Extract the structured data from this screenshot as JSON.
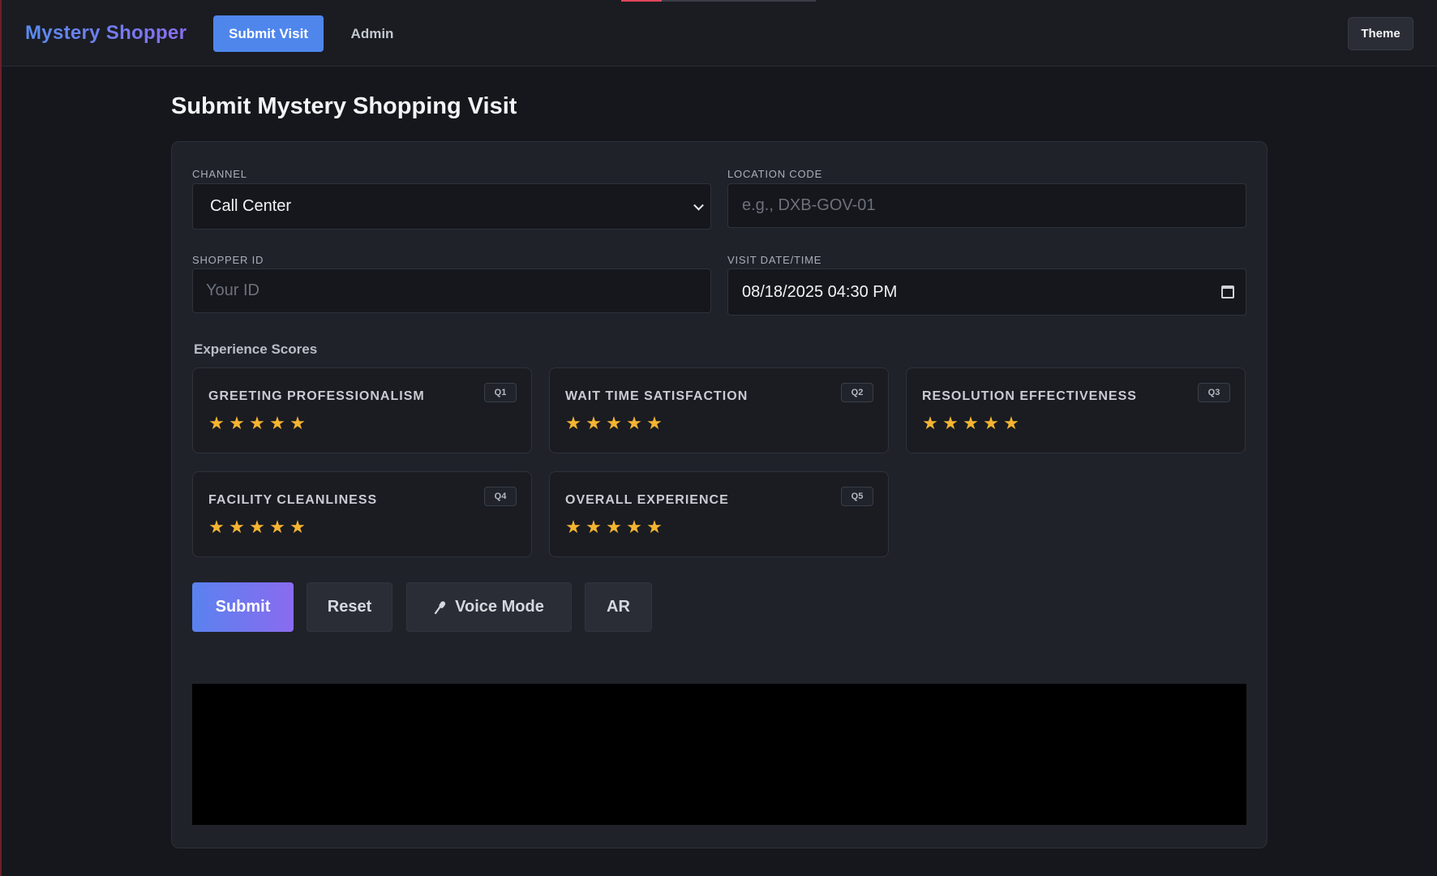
{
  "header": {
    "brand": "Mystery Shopper",
    "nav": {
      "submit_visit": "Submit Visit",
      "admin": "Admin"
    },
    "theme_label": "Theme"
  },
  "page_title": "Submit Mystery Shopping Visit",
  "form": {
    "channel": {
      "label": "CHANNEL",
      "value": "Call Center"
    },
    "location_code": {
      "label": "LOCATION CODE",
      "placeholder": "e.g., DXB-GOV-01"
    },
    "shopper_id": {
      "label": "SHOPPER ID",
      "placeholder": "Your ID"
    },
    "visit_datetime": {
      "label": "VISIT DATE/TIME",
      "value": "08/18/2025 04:30 PM"
    }
  },
  "scores": {
    "title": "Experience Scores",
    "star_glyph": "★",
    "items": [
      {
        "title": "GREETING PROFESSIONALISM",
        "badge": "Q1",
        "rating": 5
      },
      {
        "title": "WAIT TIME SATISFACTION",
        "badge": "Q2",
        "rating": 5
      },
      {
        "title": "RESOLUTION EFFECTIVENESS",
        "badge": "Q3",
        "rating": 5
      },
      {
        "title": "FACILITY CLEANLINESS",
        "badge": "Q4",
        "rating": 5
      },
      {
        "title": "OVERALL EXPERIENCE",
        "badge": "Q5",
        "rating": 5
      }
    ]
  },
  "actions": {
    "submit": "Submit",
    "reset": "Reset",
    "voice_mode": "Voice Mode",
    "ar": "AR"
  },
  "colors": {
    "accent": "#4f86ec",
    "star": "#f5b431",
    "background": "#15171c"
  }
}
